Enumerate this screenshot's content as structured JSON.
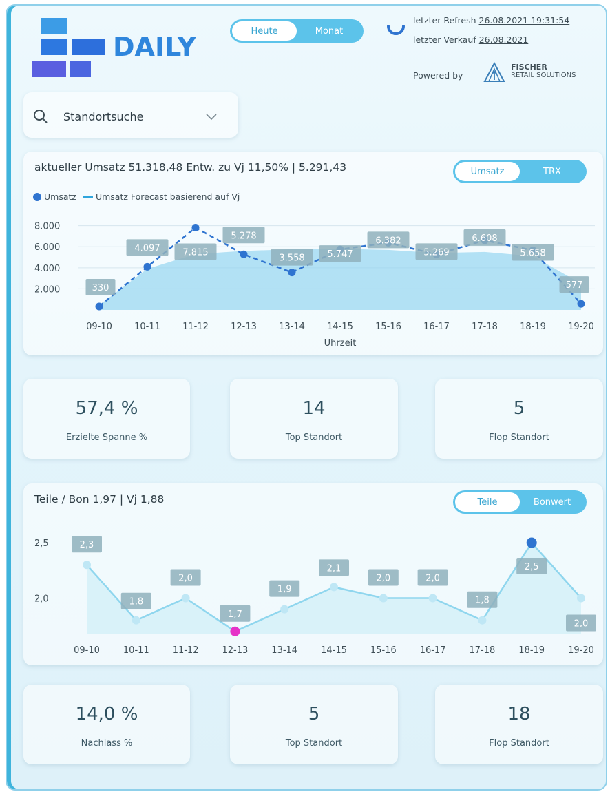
{
  "header": {
    "title": "DAILY",
    "period_toggle": {
      "options": [
        "Heute",
        "Monat"
      ],
      "active": 0
    },
    "refresh_label": "letzter Refresh",
    "refresh_value": "26.08.2021 19:31:54",
    "sale_label": "letzter Verkauf",
    "sale_value": "26.08.2021",
    "powered_by": "Powered by",
    "brand_line1": "FISCHER",
    "brand_line2": "RETAIL SOLUTIONS"
  },
  "search": {
    "placeholder": "Standortsuche"
  },
  "sales_chart_card": {
    "title": "aktueller Umsatz 51.318,48 Entw. zu Vj 11,50% | 5.291,43",
    "legend_umsatz": "Umsatz",
    "legend_forecast": "Umsatz Forecast basierend auf  Vj",
    "toggle": {
      "options": [
        "Umsatz",
        "TRX"
      ],
      "active": 0
    }
  },
  "kpis_1": [
    {
      "value": "57,4 %",
      "label": "Erzielte Spanne %"
    },
    {
      "value": "14",
      "label": "Top Standort"
    },
    {
      "value": "5",
      "label": "Flop Standort"
    }
  ],
  "parts_chart_card": {
    "title": "Teile / Bon 1,97 | Vj 1,88",
    "toggle": {
      "options": [
        "Teile",
        "Bonwert"
      ],
      "active": 0
    }
  },
  "kpis_2": [
    {
      "value": "14,0 %",
      "label": "Nachlass %"
    },
    {
      "value": "5",
      "label": "Top Standort"
    },
    {
      "value": "18",
      "label": "Flop Standort"
    }
  ],
  "colors": {
    "accent": "#5cc3ea",
    "line_dark": "#2f74d0",
    "line_light": "#8fd6ee",
    "highlight_pink": "#e633c8",
    "label_box": "#8fb0bc"
  },
  "chart_data": [
    {
      "type": "line",
      "title": "",
      "xlabel": "Uhrzeit",
      "ylabel": "",
      "categories": [
        "09-10",
        "10-11",
        "11-12",
        "12-13",
        "13-14",
        "14-15",
        "15-16",
        "16-17",
        "17-18",
        "18-19",
        "19-20"
      ],
      "y_ticks": [
        "2.000",
        "4.000",
        "6.000",
        "8.000"
      ],
      "ylim": [
        0,
        8500
      ],
      "grid": true,
      "legend": "top-left",
      "series": [
        {
          "name": "Umsatz",
          "style": "dashed-line-with-points",
          "values": [
            330,
            4097,
            7815,
            5278,
            3558,
            5747,
            6382,
            5269,
            6608,
            5658,
            577
          ],
          "labels": [
            "330",
            "4.097",
            "7.815",
            "5.278",
            "3.558",
            "5.747",
            "6.382",
            "5.269",
            "6.608",
            "5.658",
            "577"
          ]
        },
        {
          "name": "Umsatz Forecast basierend auf  Vj",
          "style": "area",
          "values": [
            450,
            3900,
            5300,
            5600,
            5750,
            5800,
            5700,
            5400,
            5500,
            5100,
            2500
          ]
        }
      ]
    },
    {
      "type": "line",
      "title": "",
      "xlabel": "",
      "ylabel": "",
      "categories": [
        "09-10",
        "10-11",
        "11-12",
        "12-13",
        "13-14",
        "14-15",
        "15-16",
        "16-17",
        "17-18",
        "18-19",
        "19-20"
      ],
      "y_ticks": [
        "2,0",
        "2,5"
      ],
      "ylim": [
        1.68,
        2.55
      ],
      "grid": false,
      "series": [
        {
          "values": [
            2.3,
            1.8,
            2.0,
            1.7,
            1.9,
            2.1,
            2.0,
            2.0,
            1.8,
            2.5,
            2.0
          ],
          "labels": [
            "2,3",
            "1,8",
            "2,0",
            "1,7",
            "1,9",
            "2,1",
            "2,0",
            "2,0",
            "1,8",
            "2,5",
            "2,0"
          ],
          "max_index": 9,
          "min_index": 3
        }
      ]
    }
  ]
}
